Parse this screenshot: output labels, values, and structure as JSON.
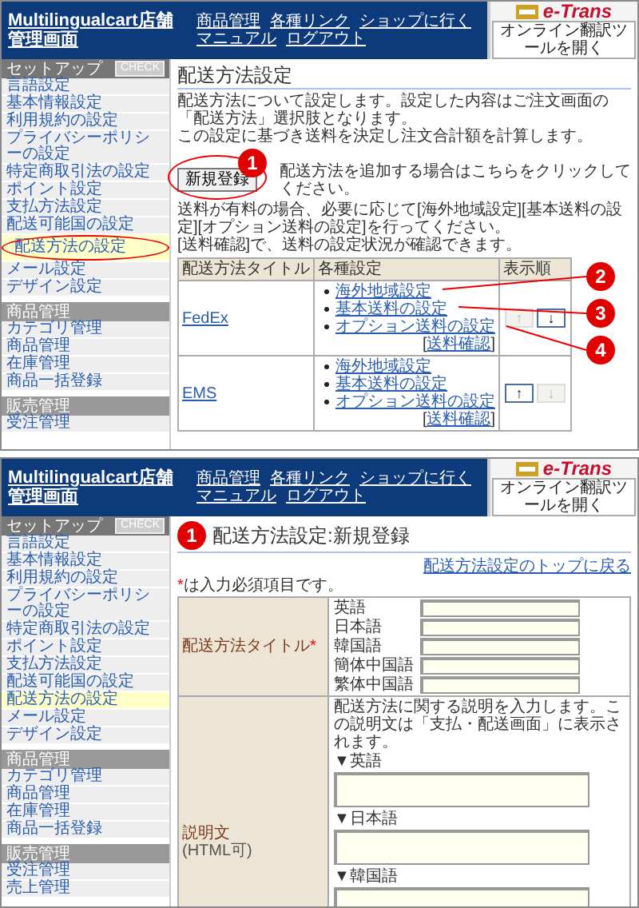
{
  "screens": [
    {
      "kind": "list",
      "header": {
        "title": "Multilingualcart店舗管理画面",
        "nav": [
          "商品管理",
          "各種リンク",
          "ショップに行く",
          "マニュアル",
          "ログアウト"
        ],
        "logo": {
          "brand": "e-Trans",
          "button": "オンライン翻訳ツールを開く"
        }
      },
      "sidebar": {
        "sections": [
          {
            "title": "セットアップ",
            "check": "CHECK",
            "items": [
              {
                "label": "言語設定",
                "selected": false,
                "highlighted": false
              },
              {
                "label": "基本情報設定",
                "selected": false,
                "highlighted": false
              },
              {
                "label": "利用規約の設定",
                "selected": false,
                "highlighted": false
              },
              {
                "label": "プライバシーポリシーの設定",
                "selected": false,
                "highlighted": false
              },
              {
                "label": "特定商取引法の設定",
                "selected": false,
                "highlighted": false
              },
              {
                "label": "ポイント設定",
                "selected": false,
                "highlighted": false
              },
              {
                "label": "支払方法設定",
                "selected": false,
                "highlighted": false
              },
              {
                "label": "配送可能国の設定",
                "selected": false,
                "highlighted": false
              },
              {
                "label": "配送方法の設定",
                "selected": true,
                "highlighted": true
              },
              {
                "label": "メール設定",
                "selected": false,
                "highlighted": false
              },
              {
                "label": "デザイン設定",
                "selected": false,
                "highlighted": false
              }
            ]
          },
          {
            "title": "商品管理",
            "items": [
              {
                "label": "カテゴリ管理",
                "selected": false,
                "highlighted": false
              },
              {
                "label": "商品管理",
                "selected": false,
                "highlighted": false
              },
              {
                "label": "在庫管理",
                "selected": false,
                "highlighted": false
              },
              {
                "label": "商品一括登録",
                "selected": false,
                "highlighted": false
              }
            ]
          },
          {
            "title": "販売管理",
            "items": [
              {
                "label": "受注管理",
                "selected": false,
                "highlighted": false
              }
            ]
          }
        ]
      },
      "page": {
        "title": "配送方法設定",
        "description": [
          "配送方法について設定します。設定した内容はご注文画面の「配送方法」選択肢となります。",
          "この設定に基づき送料を決定し注文合計額を計算します。"
        ],
        "new_button": {
          "label": "新規登録",
          "callout": "1",
          "highlighted": true,
          "hint": "配送方法を追加する場合はこちらをクリックしてください。"
        },
        "note": [
          "送料が有料の場合、必要に応じて[海外地域設定][基本送料の設定][オプション送料の設定]を行ってください。",
          "[送料確認]で、送料の設定状況が確認できます。"
        ],
        "table": {
          "columns": [
            "配送方法タイトル",
            "各種設定",
            "表示順"
          ],
          "callouts": [
            "2",
            "3",
            "4"
          ],
          "rows": [
            {
              "title": "FedEx",
              "links": [
                "海外地域設定",
                "基本送料の設定",
                "オプション送料の設定"
              ],
              "check": {
                "open": "[",
                "label": "送料確認",
                "close": "]"
              },
              "up": {
                "label": "↑",
                "disabled": true
              },
              "down": {
                "label": "↓",
                "disabled": false
              }
            },
            {
              "title": "EMS",
              "links": [
                "海外地域設定",
                "基本送料の設定",
                "オプション送料の設定"
              ],
              "check": {
                "open": "[",
                "label": "送料確認",
                "close": "]"
              },
              "up": {
                "label": "↑",
                "disabled": false
              },
              "down": {
                "label": "↓",
                "disabled": true
              }
            }
          ]
        }
      }
    },
    {
      "kind": "form",
      "header": {
        "title": "Multilingualcart店舗管理画面",
        "nav": [
          "商品管理",
          "各種リンク",
          "ショップに行く",
          "マニュアル",
          "ログアウト"
        ],
        "logo": {
          "brand": "e-Trans",
          "button": "オンライン翻訳ツールを開く"
        }
      },
      "sidebar": {
        "sections": [
          {
            "title": "セットアップ",
            "check": "CHECK",
            "items": [
              {
                "label": "言語設定",
                "selected": false,
                "highlighted": false
              },
              {
                "label": "基本情報設定",
                "selected": false,
                "highlighted": false
              },
              {
                "label": "利用規約の設定",
                "selected": false,
                "highlighted": false
              },
              {
                "label": "プライバシーポリシーの設定",
                "selected": false,
                "highlighted": false
              },
              {
                "label": "特定商取引法の設定",
                "selected": false,
                "highlighted": false
              },
              {
                "label": "ポイント設定",
                "selected": false,
                "highlighted": false
              },
              {
                "label": "支払方法設定",
                "selected": false,
                "highlighted": false
              },
              {
                "label": "配送可能国の設定",
                "selected": false,
                "highlighted": false
              },
              {
                "label": "配送方法の設定",
                "selected": true,
                "highlighted": false
              },
              {
                "label": "メール設定",
                "selected": false,
                "highlighted": false
              },
              {
                "label": "デザイン設定",
                "selected": false,
                "highlighted": false
              }
            ]
          },
          {
            "title": "商品管理",
            "items": [
              {
                "label": "カテゴリ管理",
                "selected": false,
                "highlighted": false
              },
              {
                "label": "商品管理",
                "selected": false,
                "highlighted": false
              },
              {
                "label": "在庫管理",
                "selected": false,
                "highlighted": false
              },
              {
                "label": "商品一括登録",
                "selected": false,
                "highlighted": false
              }
            ]
          },
          {
            "title": "販売管理",
            "items": [
              {
                "label": "受注管理",
                "selected": false,
                "highlighted": false
              },
              {
                "label": "売上管理",
                "selected": false,
                "highlighted": false
              }
            ]
          }
        ]
      },
      "page": {
        "callout": "1",
        "title": "配送方法設定:新規登録",
        "back_link": "配送方法設定のトップに戻る",
        "required_note": {
          "mark": "*",
          "text": "は入力必須項目です。"
        },
        "title_row": {
          "label": "配送方法タイトル",
          "mark": "*",
          "languages": [
            "英語",
            "日本語",
            "韓国語",
            "簡体中国語",
            "繁体中国語"
          ]
        },
        "description_row": {
          "label": "説明文",
          "sublabel": "(HTML可)",
          "hint": "配送方法に関する説明を入力します。この説明文は「支払・配送画面」に表示されます。",
          "languages": [
            "▼英語",
            "▼日本語",
            "▼韓国語"
          ]
        }
      }
    }
  ]
}
